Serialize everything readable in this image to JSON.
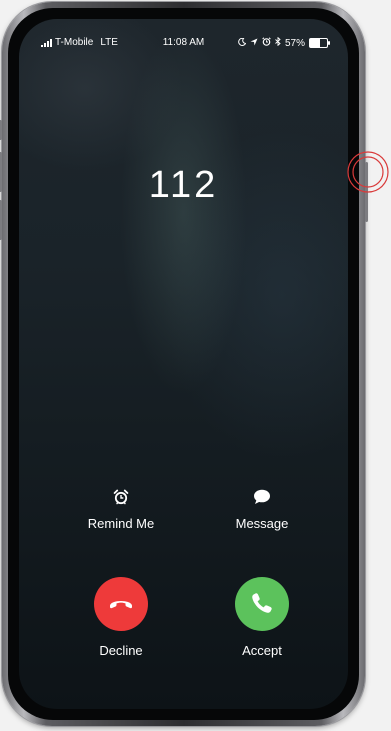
{
  "status_bar": {
    "carrier": "T-Mobile",
    "network": "LTE",
    "time": "11:08 AM",
    "battery": "57%",
    "battery_level": 0.57,
    "icons": [
      "moon-icon",
      "location-arrow-icon",
      "alarm-icon",
      "bluetooth-icon",
      "battery-icon"
    ]
  },
  "call": {
    "caller": "112"
  },
  "actions": {
    "remind_label": "Remind Me",
    "message_label": "Message",
    "decline_label": "Decline",
    "accept_label": "Accept"
  },
  "colors": {
    "decline": "#ee3a3a",
    "accept": "#5cc25c",
    "touch_ring": "#d93a3a"
  }
}
